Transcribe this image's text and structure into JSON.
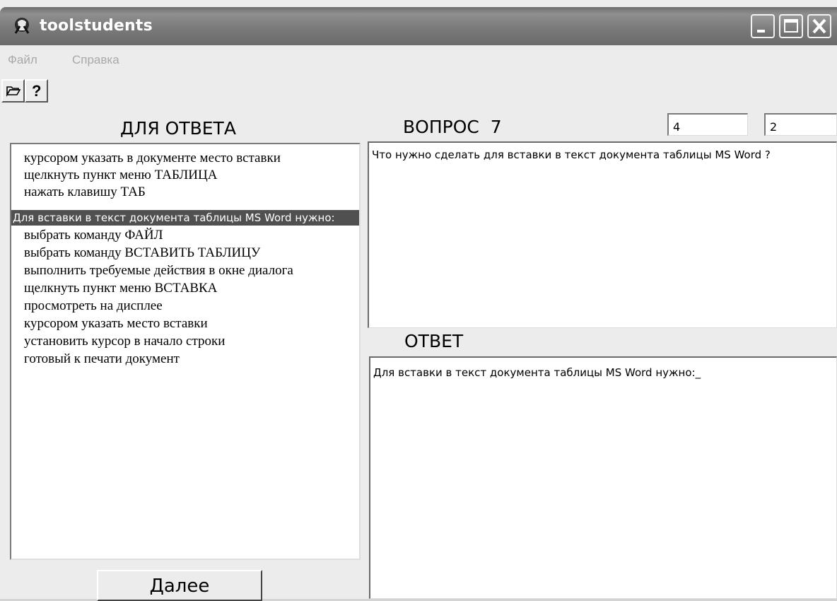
{
  "window": {
    "title": "toolstudents"
  },
  "menu": {
    "items": [
      "Файл",
      "Справка"
    ]
  },
  "toolbar": {
    "open_icon": "folder-open-icon",
    "help_label": "?"
  },
  "left_panel": {
    "header": "ДЛЯ ОТВЕТА",
    "items": [
      "курсором указать в документе место вставки",
      "щелкнуть пункт меню ТАБЛИЦА",
      "нажать клавишу ТАБ",
      "Для вставки в текст документа таблицы MS Word  нужно:",
      "выбрать команду ФАЙЛ",
      "выбрать команду ВСТАВИТЬ ТАБЛИЦУ",
      "выполнить требуемые действия в окне диалога",
      "щелкнуть пункт меню ВСТАВКА",
      "просмотреть на дисплее",
      "курсором указать место вставки",
      "установить курсор в начало строки",
      "готовый к печати документ"
    ],
    "selected_index": 3,
    "next_button": "Далее"
  },
  "question": {
    "header": "ВОПРОС  7",
    "field1": "4",
    "field2": "2",
    "text": "Что нужно сделать для вставки в текст документа таблицы MS Word ?"
  },
  "answer": {
    "header": "ОТВЕТ",
    "text": "Для вставки в текст документа таблицы MS Word  нужно:_"
  }
}
